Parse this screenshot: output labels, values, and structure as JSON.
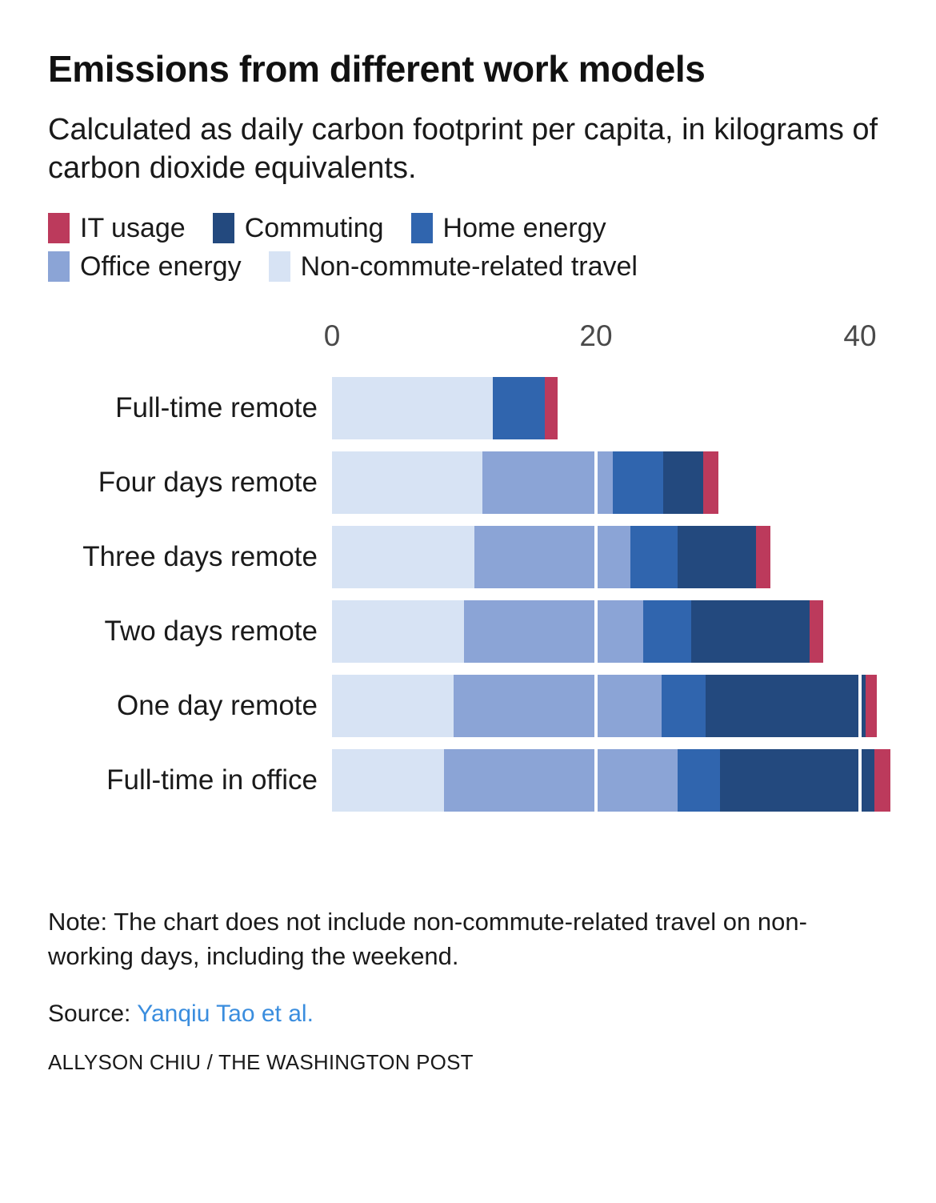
{
  "header": {
    "title": "Emissions from different work models",
    "subtitle": "Calculated as daily carbon footprint per capita, in kilograms of carbon dioxide equivalents."
  },
  "footer": {
    "note": "Note: The chart does not include non-commute-related travel on non-working days, including the weekend.",
    "source_prefix": "Source: ",
    "source_link": "Yanqiu Tao et al.",
    "credit": "ALLYSON CHIU / THE WASHINGTON POST"
  },
  "colors": {
    "it_usage": "#bc3a5c",
    "commuting": "#23497e",
    "home_energy": "#3065ae",
    "office_energy": "#8ba4d6",
    "non_commute_travel": "#d7e3f4",
    "source_link": "#3a8dde",
    "text": "#1a1a1a",
    "background": "#ffffff"
  },
  "chart_data": {
    "type": "bar",
    "orientation": "horizontal",
    "stacked": true,
    "title": "Emissions from different work models",
    "subtitle": "Calculated as daily carbon footprint per capita, in kilograms of carbon dioxide equivalents.",
    "xlabel": "",
    "ylabel": "",
    "xlim": [
      0,
      42.6
    ],
    "xticks": [
      0,
      20,
      40
    ],
    "xtick_labels": [
      "0",
      "20",
      "40"
    ],
    "grid": true,
    "legend_position": "top",
    "legend": [
      {
        "name": "IT usage",
        "color": "#bc3a5c"
      },
      {
        "name": "Commuting",
        "color": "#23497e"
      },
      {
        "name": "Home energy",
        "color": "#3065ae"
      },
      {
        "name": "Office energy",
        "color": "#8ba4d6"
      },
      {
        "name": "Non-commute-related travel",
        "color": "#d7e3f4"
      }
    ],
    "categories": [
      "Full-time remote",
      "Four days remote",
      "Three days remote",
      "Two days remote",
      "One day remote",
      "Full-time in office"
    ],
    "stack_order": [
      "Non-commute-related travel",
      "Office energy",
      "Home energy",
      "Commuting",
      "IT usage"
    ],
    "series": [
      {
        "name": "Non-commute-related travel",
        "color": "#d7e3f4",
        "values": [
          12.2,
          11.4,
          10.8,
          10.0,
          9.2,
          8.5
        ]
      },
      {
        "name": "Office energy",
        "color": "#8ba4d6",
        "values": [
          0.0,
          9.9,
          11.8,
          13.6,
          15.8,
          17.7
        ]
      },
      {
        "name": "Home energy",
        "color": "#3065ae",
        "values": [
          3.9,
          3.8,
          3.6,
          3.6,
          3.3,
          3.2
        ]
      },
      {
        "name": "Commuting",
        "color": "#23497e",
        "values": [
          0.0,
          3.0,
          5.9,
          9.0,
          12.1,
          11.7
        ]
      },
      {
        "name": "IT usage",
        "color": "#bc3a5c",
        "values": [
          1.0,
          1.2,
          1.1,
          1.0,
          0.9,
          1.2
        ]
      }
    ],
    "totals": [
      17.1,
      29.3,
      33.2,
      37.2,
      41.3,
      42.3
    ]
  }
}
